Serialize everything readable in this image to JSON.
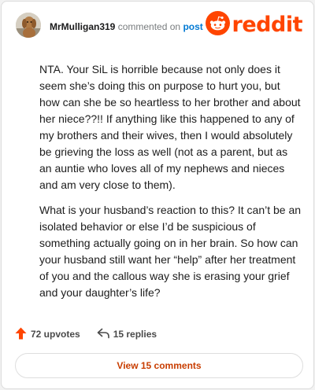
{
  "comment": {
    "username": "MrMulligan319",
    "commented_on_text": "commented on",
    "post_link": "post",
    "paragraphs": [
      "NTA. Your SiL is horrible because not only does it seem she’s doing this on purpose to hurt you, but how can she be so heartless to her brother and about her niece??!! If anything like this happened to any of my brothers and their wives, then I would absolutely be grieving the loss as well (not as a parent, but as an auntie who loves all of my nephews and nieces and am very close to them).",
      "What is your husband’s reaction to this? It can’t be an isolated behavior or else I’d be suspicious of something actually going on in her brain. So how can your husband still want her “help” after her treatment of you and the callous way she is erasing your grief and your daughter’s life?"
    ]
  },
  "logo": {
    "wordmark": "reddit",
    "icon": "reddit-snoo-icon"
  },
  "actions": {
    "upvotes_label": "72 upvotes",
    "replies_label": "15 replies",
    "upvote_icon": "upvote-arrow-icon",
    "reply_icon": "reply-arrow-icon"
  },
  "view_button": {
    "label": "View 15 comments"
  },
  "colors": {
    "brand": "#ff4500",
    "link": "#0079d3",
    "button_text": "#c83d00",
    "upvote": "#ff4500"
  }
}
